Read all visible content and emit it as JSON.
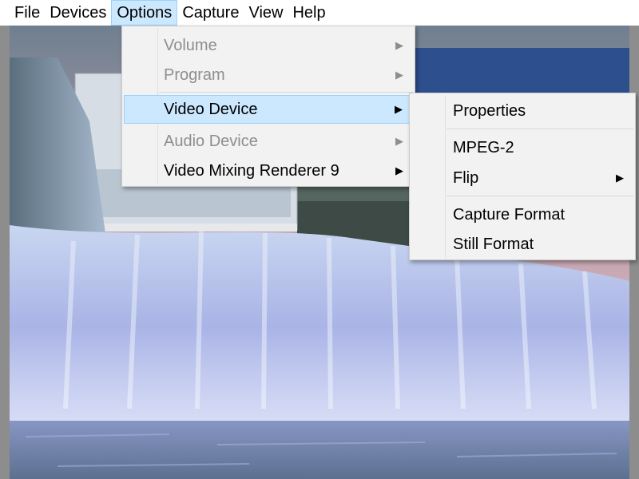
{
  "menubar": {
    "items": [
      {
        "label": "File"
      },
      {
        "label": "Devices"
      },
      {
        "label": "Options"
      },
      {
        "label": "Capture"
      },
      {
        "label": "View"
      },
      {
        "label": "Help"
      }
    ]
  },
  "options_menu": {
    "items": [
      {
        "label": "Volume",
        "enabled": false,
        "submenu_arrow": "▶"
      },
      {
        "label": "Program",
        "enabled": false,
        "submenu_arrow": "▶"
      },
      {
        "label": "Video Device",
        "enabled": true,
        "submenu_arrow": "▶",
        "highlighted": true
      },
      {
        "label": "Audio Device",
        "enabled": false,
        "submenu_arrow": "▶"
      },
      {
        "label": "Video Mixing Renderer 9",
        "enabled": true,
        "submenu_arrow": "▶"
      }
    ]
  },
  "video_device_submenu": {
    "items": [
      {
        "label": "Properties"
      },
      {
        "label": "MPEG-2"
      },
      {
        "label": "Flip",
        "submenu_arrow": "▶"
      },
      {
        "label": "Capture Format"
      },
      {
        "label": "Still Format"
      }
    ]
  },
  "colors": {
    "highlight_bg": "#cce8ff",
    "highlight_border": "#99d1ff",
    "menu_bg": "#f2f2f2",
    "disabled_text": "#8e8e8e"
  }
}
